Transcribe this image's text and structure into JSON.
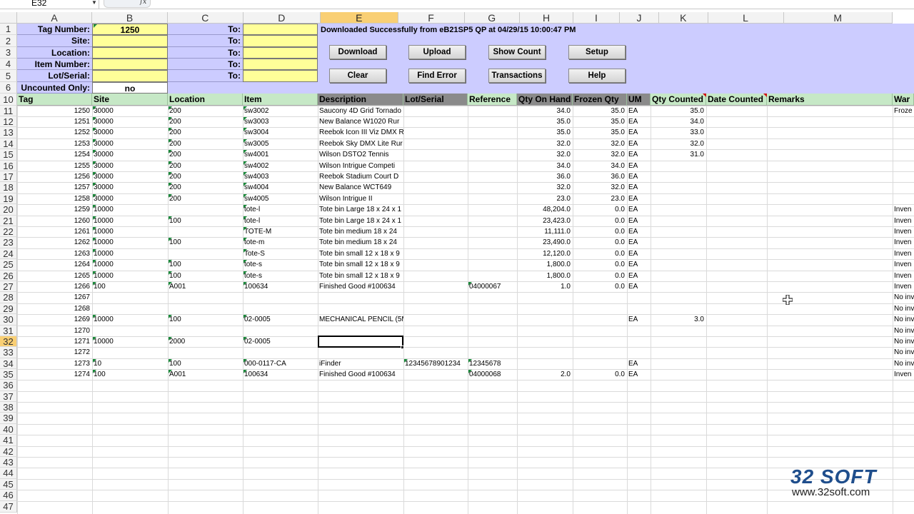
{
  "formula_bar": {
    "name_box": "E32",
    "fx_symbol": "fx",
    "formula": ""
  },
  "columns": [
    "A",
    "B",
    "C",
    "D",
    "E",
    "F",
    "G",
    "H",
    "I",
    "J",
    "K",
    "L",
    "M"
  ],
  "selected_column": "E",
  "selected_row": "32",
  "row_numbers": [
    "1",
    "2",
    "3",
    "4",
    "5",
    "6",
    "10",
    "11",
    "12",
    "13",
    "14",
    "15",
    "16",
    "17",
    "18",
    "19",
    "20",
    "21",
    "22",
    "23",
    "24",
    "25",
    "26",
    "27",
    "28",
    "29",
    "30",
    "31",
    "32",
    "33",
    "34",
    "35",
    "36",
    "37",
    "38",
    "39",
    "40",
    "41",
    "42",
    "43",
    "44",
    "45",
    "46",
    "47"
  ],
  "filter_panel": {
    "labels": [
      "Tag Number:",
      "Site:",
      "Location:",
      "Item Number:",
      "Lot/Serial:",
      "Uncounted Only:"
    ],
    "values": [
      "1250",
      "",
      "",
      "",
      "",
      "no"
    ],
    "to_labels": [
      "To:",
      "To:",
      "To:",
      "To:",
      "To:"
    ]
  },
  "status_message": "Downloaded Successfully from eB21SP5 QP at 04/29/15 10:00:47 PM",
  "buttons": {
    "download": "Download",
    "upload": "Upload",
    "show_count": "Show Count",
    "setup": "Setup",
    "clear": "Clear",
    "find_error": "Find Error",
    "transactions": "Transactions",
    "help": "Help"
  },
  "table": {
    "headers": [
      "Tag",
      "Site",
      "Location",
      "Item",
      "Description",
      "Lot/Serial",
      "Reference",
      "Qty On Hand",
      "Frozen Qty",
      "UM",
      "Qty Counted",
      "Date Counted",
      "Remarks",
      "War"
    ],
    "rows": [
      [
        "1250",
        "30000",
        "200",
        "sw3002",
        "Saucony 4D Grid Tornado",
        "",
        "",
        "34.0",
        "35.0",
        "EA",
        "35.0",
        "",
        "",
        "Froze"
      ],
      [
        "1251",
        "30000",
        "200",
        "sw3003",
        "New Balance W1020 Rur",
        "",
        "",
        "35.0",
        "35.0",
        "EA",
        "34.0",
        "",
        "",
        ""
      ],
      [
        "1252",
        "30000",
        "200",
        "sw3004",
        "Reebok Icon III Viz DMX R",
        "",
        "",
        "35.0",
        "35.0",
        "EA",
        "33.0",
        "",
        "",
        ""
      ],
      [
        "1253",
        "30000",
        "200",
        "sw3005",
        "Reebok Sky DMX Lite Rur",
        "",
        "",
        "32.0",
        "32.0",
        "EA",
        "32.0",
        "",
        "",
        ""
      ],
      [
        "1254",
        "30000",
        "200",
        "sw4001",
        "Wilson DSTO2 Tennis",
        "",
        "",
        "32.0",
        "32.0",
        "EA",
        "31.0",
        "",
        "",
        ""
      ],
      [
        "1255",
        "30000",
        "200",
        "sw4002",
        "Wilson Intrigue Competi",
        "",
        "",
        "34.0",
        "34.0",
        "EA",
        "",
        "",
        "",
        ""
      ],
      [
        "1256",
        "30000",
        "200",
        "sw4003",
        "Reebok Stadium Court D",
        "",
        "",
        "36.0",
        "36.0",
        "EA",
        "",
        "",
        "",
        ""
      ],
      [
        "1257",
        "30000",
        "200",
        "sw4004",
        "New Balance WCT649",
        "",
        "",
        "32.0",
        "32.0",
        "EA",
        "",
        "",
        "",
        ""
      ],
      [
        "1258",
        "30000",
        "200",
        "sw4005",
        "Wilson Intrigue II",
        "",
        "",
        "23.0",
        "23.0",
        "EA",
        "",
        "",
        "",
        ""
      ],
      [
        "1259",
        "10000",
        "",
        "tote-l",
        "Tote bin Large 18 x 24 x 1",
        "",
        "",
        "48,204.0",
        "0.0",
        "EA",
        "",
        "",
        "",
        "Inven"
      ],
      [
        "1260",
        "10000",
        "100",
        "tote-l",
        "Tote bin Large 18 x 24 x 1",
        "",
        "",
        "23,423.0",
        "0.0",
        "EA",
        "",
        "",
        "",
        "Inven"
      ],
      [
        "1261",
        "10000",
        "",
        "TOTE-M",
        "Tote bin medium 18 x 24",
        "",
        "",
        "11,111.0",
        "0.0",
        "EA",
        "",
        "",
        "",
        "Inven"
      ],
      [
        "1262",
        "10000",
        "100",
        "tote-m",
        "Tote bin medium 18 x 24",
        "",
        "",
        "23,490.0",
        "0.0",
        "EA",
        "",
        "",
        "",
        "Inven"
      ],
      [
        "1263",
        "10000",
        "",
        "Tote-S",
        "Tote bin small 12 x 18 x 9",
        "",
        "",
        "12,120.0",
        "0.0",
        "EA",
        "",
        "",
        "",
        "Inven"
      ],
      [
        "1264",
        "10000",
        "100",
        "tote-s",
        "Tote bin small 12 x 18 x 9",
        "",
        "",
        "1,800.0",
        "0.0",
        "EA",
        "",
        "",
        "",
        "Inven"
      ],
      [
        "1265",
        "10000",
        "100",
        "tote-s",
        "Tote bin small 12 x 18 x 9",
        "",
        "",
        "1,800.0",
        "0.0",
        "EA",
        "",
        "",
        "",
        "Inven"
      ],
      [
        "1266",
        "100",
        "A001",
        "100634",
        "Finished Good #100634",
        "",
        "04000067",
        "1.0",
        "0.0",
        "EA",
        "",
        "",
        "",
        "Inven"
      ],
      [
        "1267",
        "",
        "",
        "",
        "",
        "",
        "",
        "",
        "",
        "",
        "",
        "",
        "",
        "No inv"
      ],
      [
        "1268",
        "",
        "",
        "",
        "",
        "",
        "",
        "",
        "",
        "",
        "",
        "",
        "",
        "No inv"
      ],
      [
        "1269",
        "10000",
        "100",
        "02-0005",
        "MECHANICAL PENCIL (5M",
        "",
        "",
        "",
        "",
        "EA",
        "3.0",
        "",
        "",
        "No inv"
      ],
      [
        "1270",
        "",
        "",
        "",
        "",
        "",
        "",
        "",
        "",
        "",
        "",
        "",
        "",
        "No inv"
      ],
      [
        "1271",
        "10000",
        "2000",
        "02-0005",
        "",
        "",
        "",
        "",
        "",
        "",
        "",
        "",
        "",
        "No inv"
      ],
      [
        "1272",
        "",
        "",
        "",
        "",
        "",
        "",
        "",
        "",
        "",
        "",
        "",
        "",
        "No inv"
      ],
      [
        "1273",
        "10",
        "100",
        "000-0117-CA",
        "iFinder",
        "12345678901234",
        "12345678",
        "",
        "",
        "EA",
        "",
        "",
        "",
        "No inv"
      ],
      [
        "1274",
        "100",
        "A001",
        "100634",
        "Finished Good #100634",
        "",
        "04000068",
        "2.0",
        "0.0",
        "EA",
        "",
        "",
        "",
        "Inven"
      ]
    ]
  },
  "watermark": {
    "logo": "32 SOFT",
    "url": "www.32soft.com"
  },
  "colors": {
    "panel_bg": "#ccccff",
    "input_yellow": "#ffff99",
    "header_green": "#c6e8c6",
    "header_dark": "#8a8a8a",
    "selection": "#f9cf74",
    "logo": "#1f4e8c"
  }
}
